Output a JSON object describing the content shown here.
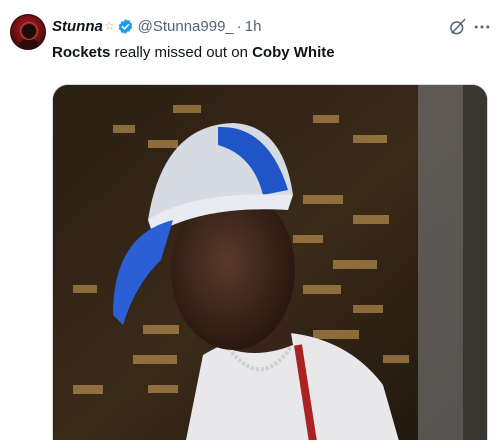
{
  "tweet": {
    "display_name": "Stunna",
    "name_emoji": "☆",
    "handle": "@Stunna999_",
    "separator": "·",
    "time": "1h",
    "text_part1": "Rockets",
    "text_part2": " really missed out on ",
    "text_part3": "Coby White"
  },
  "icons": {
    "avatar": "avatar",
    "verified": "verified-badge-icon",
    "grok": "grok-icon",
    "more": "more-icon"
  },
  "colors": {
    "verified": "#1d9bf0",
    "text_secondary": "#536471",
    "text_primary": "#0f1419"
  }
}
